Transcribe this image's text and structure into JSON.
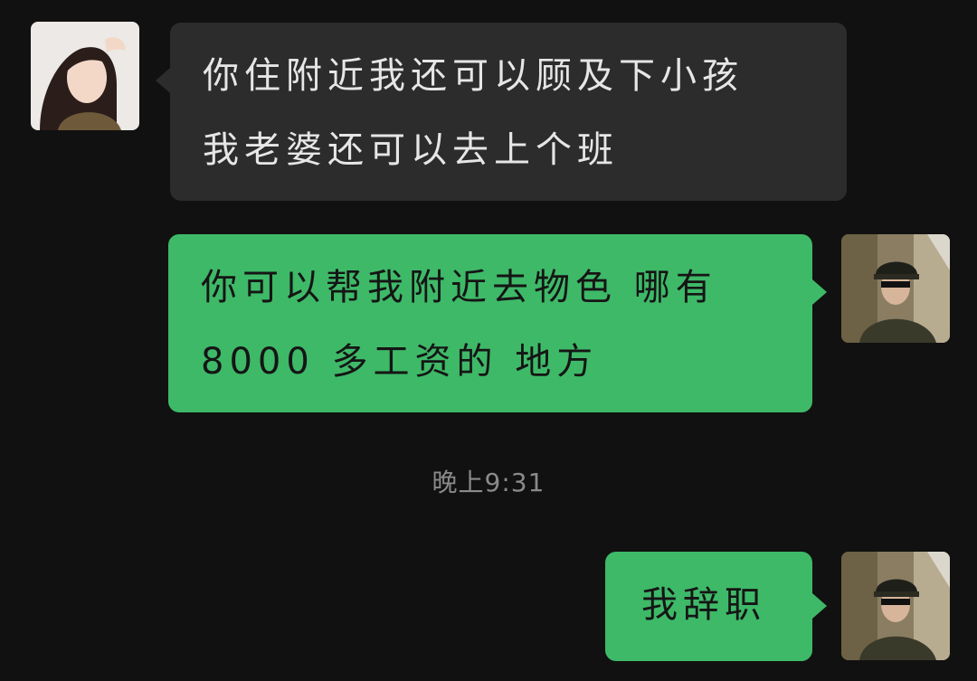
{
  "messages": [
    {
      "side": "left",
      "lines": [
        "你住附近我还可以顾及下小孩",
        "我老婆还可以去上个班"
      ]
    },
    {
      "side": "right",
      "lines": [
        "你可以帮我附近去物色 哪有",
        "8000 多工资的 地方"
      ]
    },
    {
      "side": "right",
      "lines": [
        "我辞职"
      ]
    }
  ],
  "timestamp": "晚上9:31",
  "colors": {
    "background": "#111111",
    "incoming_bubble": "#2c2c2c",
    "outgoing_bubble": "#3eb968",
    "timestamp_text": "#8a8a8a"
  },
  "icons": {
    "left_avatar": "woman-portrait-avatar-icon",
    "right_avatar": "officer-portrait-avatar-icon"
  }
}
